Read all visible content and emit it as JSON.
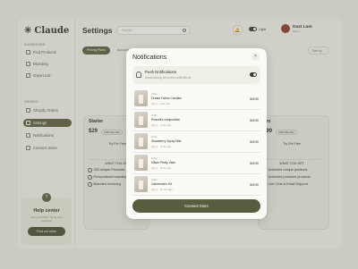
{
  "app": {
    "name": "Claude"
  },
  "sidebar": {
    "sections": [
      {
        "label": "DASHBOARD",
        "items": [
          {
            "label": "Find Products"
          },
          {
            "label": "Branding"
          },
          {
            "label": "Import List"
          }
        ]
      },
      {
        "label": "ORDERS",
        "items": [
          {
            "label": "Shopify Orders"
          },
          {
            "label": "Settings"
          },
          {
            "label": "Notifications"
          },
          {
            "label": "Connect Store"
          }
        ]
      }
    ],
    "active_item": "Settings"
  },
  "help": {
    "badge": "?",
    "title": "Help center",
    "subtitle": "Having trouble? Send us a message",
    "button": "Find out more"
  },
  "header": {
    "title": "Settings",
    "search_placeholder": "Search...",
    "theme_label": "Light",
    "user_name": "Dast Lam",
    "user_role": "Admin"
  },
  "tabs": [
    "Pricing Plans",
    "Account"
  ],
  "sort_label": "Sort by",
  "plans": [
    {
      "name": "Starter",
      "price": "$29",
      "badge": "USD Monthly",
      "trial": "Try For Free",
      "section": "WHAT YOU GET",
      "features": [
        "250 unique Products",
        "Personalized branding",
        "Branded Invoicing"
      ]
    },
    {
      "name": "Pro",
      "price": "$99",
      "badge": "USD Monthly",
      "trial": "Try For Free",
      "section": "WHAT YOU GET",
      "features": [
        "Unlimited unique products",
        "Unlimited premium products",
        "Live Chat & Email Support"
      ]
    }
  ],
  "modal": {
    "title": "Notifications",
    "close": "×",
    "push": {
      "title": "Push Notifications",
      "subtitle": "Automatically send new notifications"
    },
    "items": [
      {
        "label": "Order",
        "name": "Dream Fabric Candles",
        "meta": "Qty: 1 · Just now",
        "price": "$49.90"
      },
      {
        "label": "Order",
        "name": "Peaceful composition",
        "meta": "Qty: 1 · 2 min ago",
        "price": "$49.90"
      },
      {
        "label": "Order",
        "name": "Strawberry Spray Mist",
        "meta": "Qty: 1 · 5 min ago",
        "price": "$49.90"
      },
      {
        "label": "Order",
        "name": "Mikes Pretty Vase",
        "meta": "Qty: 1 · 8 min ago",
        "price": "$49.90"
      },
      {
        "label": "Order",
        "name": "Gamemak's Kit",
        "meta": "Qty: 1 · 10 min ago",
        "price": "$49.90"
      }
    ],
    "button": "Connect Store"
  }
}
